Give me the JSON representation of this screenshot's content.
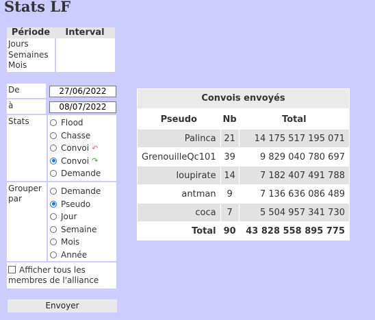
{
  "page": {
    "title": "Stats LF"
  },
  "period": {
    "headers": [
      "Période",
      "Interval"
    ],
    "items": [
      "Jours",
      "Semaines",
      "Mois"
    ]
  },
  "form": {
    "from_label": "De",
    "from_value": "27/06/2022",
    "to_label": "à",
    "to_value": "08/07/2022",
    "stats_label": "Stats",
    "stats_options": [
      {
        "label": "Flood",
        "selected": false
      },
      {
        "label": "Chasse",
        "selected": false
      },
      {
        "label": "Convoi",
        "selected": false,
        "icon": "red-arrow-icon"
      },
      {
        "label": "Convoi",
        "selected": true,
        "icon": "green-arrow-icon"
      },
      {
        "label": "Demande",
        "selected": false
      }
    ],
    "group_label": "Grouper par",
    "group_options": [
      {
        "label": "Demande",
        "selected": false
      },
      {
        "label": "Pseudo",
        "selected": true
      },
      {
        "label": "Jour",
        "selected": false
      },
      {
        "label": "Semaine",
        "selected": false
      },
      {
        "label": "Mois",
        "selected": false
      },
      {
        "label": "Année",
        "selected": false
      }
    ],
    "all_members_label": "Afficher tous les membres de l'alliance",
    "all_members_checked": false,
    "submit_label": "Envoyer"
  },
  "results": {
    "caption": "Convois envoyés",
    "headers": [
      "Pseudo",
      "Nb",
      "Total"
    ],
    "rows": [
      {
        "pseudo": "Palinca",
        "nb": "21",
        "total": "14 175 517 195 071"
      },
      {
        "pseudo": "GrenouilleQc101",
        "nb": "39",
        "total": "9 829 040 780 697"
      },
      {
        "pseudo": "loupirate",
        "nb": "14",
        "total": "7 182 407 491 788"
      },
      {
        "pseudo": "antman",
        "nb": "9",
        "total": "7 136 636 086 489"
      },
      {
        "pseudo": "coca",
        "nb": "7",
        "total": "5 504 957 341 730"
      }
    ],
    "total_row": {
      "label": "Total",
      "nb": "90",
      "total": "43 828 558 895 775"
    }
  }
}
